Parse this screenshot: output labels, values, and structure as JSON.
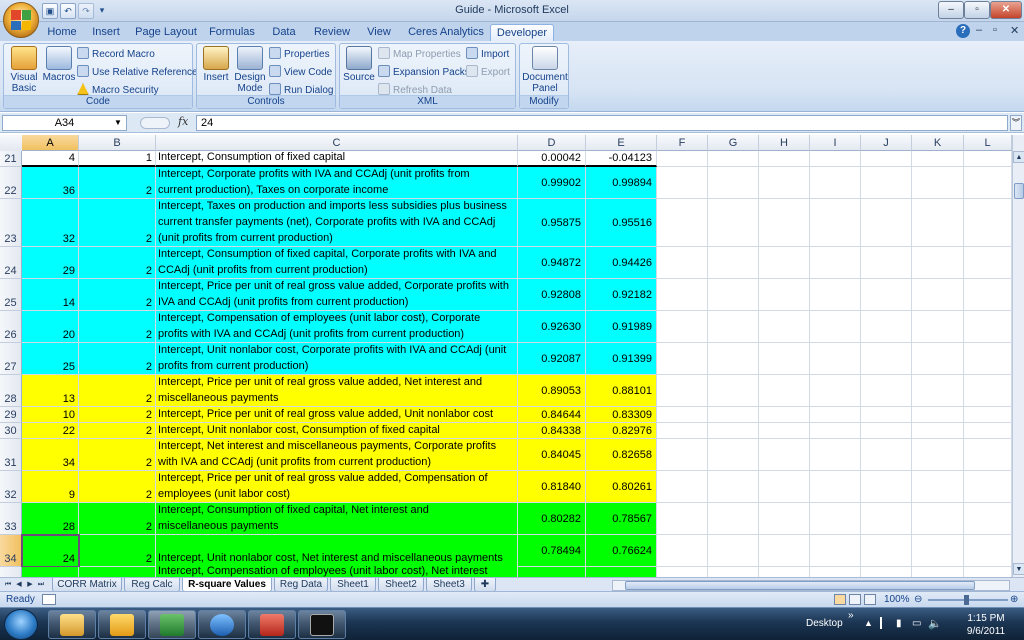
{
  "window": {
    "title": "Guide - Microsoft Excel",
    "min": "–",
    "restore": "▫",
    "close": "✕"
  },
  "qat": {
    "save_icon": "save-icon",
    "undo": "↶",
    "redo": "↷",
    "more": "▾"
  },
  "ribbon_tabs": [
    "Home",
    "Insert",
    "Page Layout",
    "Formulas",
    "Data",
    "Review",
    "View",
    "Ceres Analytics",
    "Developer"
  ],
  "ribbon_right": {
    "help": "?",
    "min": "–",
    "restore": "▫",
    "close": "✕"
  },
  "groups": {
    "code": {
      "label": "Code",
      "visual_basic": "Visual\nBasic",
      "macros": "Macros",
      "record_macro": "Record Macro",
      "relative_refs": "Use Relative References",
      "macro_security": "Macro Security"
    },
    "controls": {
      "label": "Controls",
      "insert": "Insert",
      "design_mode": "Design\nMode",
      "properties": "Properties",
      "view_code": "View Code",
      "run_dialog": "Run Dialog"
    },
    "xml": {
      "label": "XML",
      "source": "Source",
      "map_properties": "Map Properties",
      "expansion_packs": "Expansion Packs",
      "refresh_data": "Refresh Data",
      "import": "Import",
      "export": "Export"
    },
    "modify": {
      "label": "Modify",
      "document_panel": "Document\nPanel"
    }
  },
  "formula_bar": {
    "name_box": "A34",
    "fx": "fx",
    "formula": "24"
  },
  "columns": [
    "A",
    "B",
    "C",
    "D",
    "E",
    "F",
    "G",
    "H",
    "I",
    "J",
    "K",
    "L"
  ],
  "rows": [
    {
      "n": "21",
      "a": "4",
      "b": "1",
      "c": "Intercept,   Consumption of fixed capital",
      "d": "0.00042",
      "e": "-0.04123",
      "fill": "#ffffff"
    },
    {
      "n": "22",
      "a": "36",
      "b": "2",
      "c": "Intercept, Corporate profits with IVA and CCAdj (unit profits from\ncurrent production),   Taxes on corporate income",
      "d": "0.99902",
      "e": "0.99894",
      "fill": "#00ffff"
    },
    {
      "n": "23",
      "a": "32",
      "b": "2",
      "c": "Intercept,   Taxes on production and imports less subsidies plus business\ncurrent transfer payments (net), Corporate profits with IVA and CCAdj\n(unit profits from current production)",
      "d": "0.95875",
      "e": "0.95516",
      "fill": "#00ffff"
    },
    {
      "n": "24",
      "a": "29",
      "b": "2",
      "c": "Intercept,   Consumption of fixed capital, Corporate profits with IVA and\nCCAdj (unit profits from current production)",
      "d": "0.94872",
      "e": "0.94426",
      "fill": "#00ffff"
    },
    {
      "n": "25",
      "a": "14",
      "b": "2",
      "c": "Intercept, Price per unit of real gross value added, Corporate profits with\nIVA and CCAdj (unit profits from current production)",
      "d": "0.92808",
      "e": "0.92182",
      "fill": "#00ffff"
    },
    {
      "n": "26",
      "a": "20",
      "b": "2",
      "c": "Intercept, Compensation of employees (unit labor cost), Corporate\nprofits with IVA and CCAdj (unit profits from current production)",
      "d": "0.92630",
      "e": "0.91989",
      "fill": "#00ffff"
    },
    {
      "n": "27",
      "a": "25",
      "b": "2",
      "c": "Intercept, Unit nonlabor cost, Corporate profits with IVA and CCAdj (unit\nprofits from current production)",
      "d": "0.92087",
      "e": "0.91399",
      "fill": "#00ffff"
    },
    {
      "n": "28",
      "a": "13",
      "b": "2",
      "c": "Intercept, Price per unit of real gross value added,   Net interest and\nmiscellaneous payments",
      "d": "0.89053",
      "e": "0.88101",
      "fill": "#ffff00"
    },
    {
      "n": "29",
      "a": "10",
      "b": "2",
      "c": "Intercept, Price per unit of real gross value added, Unit nonlabor cost",
      "d": "0.84644",
      "e": "0.83309",
      "fill": "#ffff00"
    },
    {
      "n": "30",
      "a": "22",
      "b": "2",
      "c": "Intercept, Unit nonlabor cost,   Consumption of fixed capital",
      "d": "0.84338",
      "e": "0.82976",
      "fill": "#ffff00"
    },
    {
      "n": "31",
      "a": "34",
      "b": "2",
      "c": "Intercept,   Net interest and miscellaneous payments, Corporate profits\nwith IVA and CCAdj (unit profits from current production)",
      "d": "0.84045",
      "e": "0.82658",
      "fill": "#ffff00"
    },
    {
      "n": "32",
      "a": "9",
      "b": "2",
      "c": "Intercept, Price per unit of real gross value added, Compensation of\nemployees (unit labor cost)",
      "d": "0.81840",
      "e": "0.80261",
      "fill": "#ffff00"
    },
    {
      "n": "33",
      "a": "28",
      "b": "2",
      "c": "Intercept,   Consumption of fixed capital,   Net interest and\nmiscellaneous payments",
      "d": "0.80282",
      "e": "0.78567",
      "fill": "#00ff00"
    },
    {
      "n": "34",
      "a": "24",
      "b": "2",
      "c": "Intercept, Unit nonlabor cost,   Net interest and miscellaneous payments",
      "d": "0.78494",
      "e": "0.76624",
      "fill": "#00ff00"
    },
    {
      "n": "",
      "a": "",
      "b": "",
      "c": "Intercept, Compensation of employees (unit labor cost),   Net interest",
      "d": "",
      "e": "",
      "fill": "#00ff00"
    }
  ],
  "sheet_tabs": [
    "CORR Matrix",
    "Reg Calc",
    "R-square Values",
    "Reg Data",
    "Sheet1",
    "Sheet2",
    "Sheet3"
  ],
  "active_sheet": "R-square Values",
  "status": {
    "mode": "Ready",
    "zoom": "100%"
  },
  "taskbar": {
    "desktop": "Desktop",
    "more": "»",
    "time": "1:15 PM",
    "date": "9/6/2011"
  },
  "colors": {
    "cyan": "#00ffff",
    "yellow": "#ffff00",
    "green": "#00ff00",
    "ribbon": "#dbe7f6",
    "taskbar": "#1b3553"
  }
}
